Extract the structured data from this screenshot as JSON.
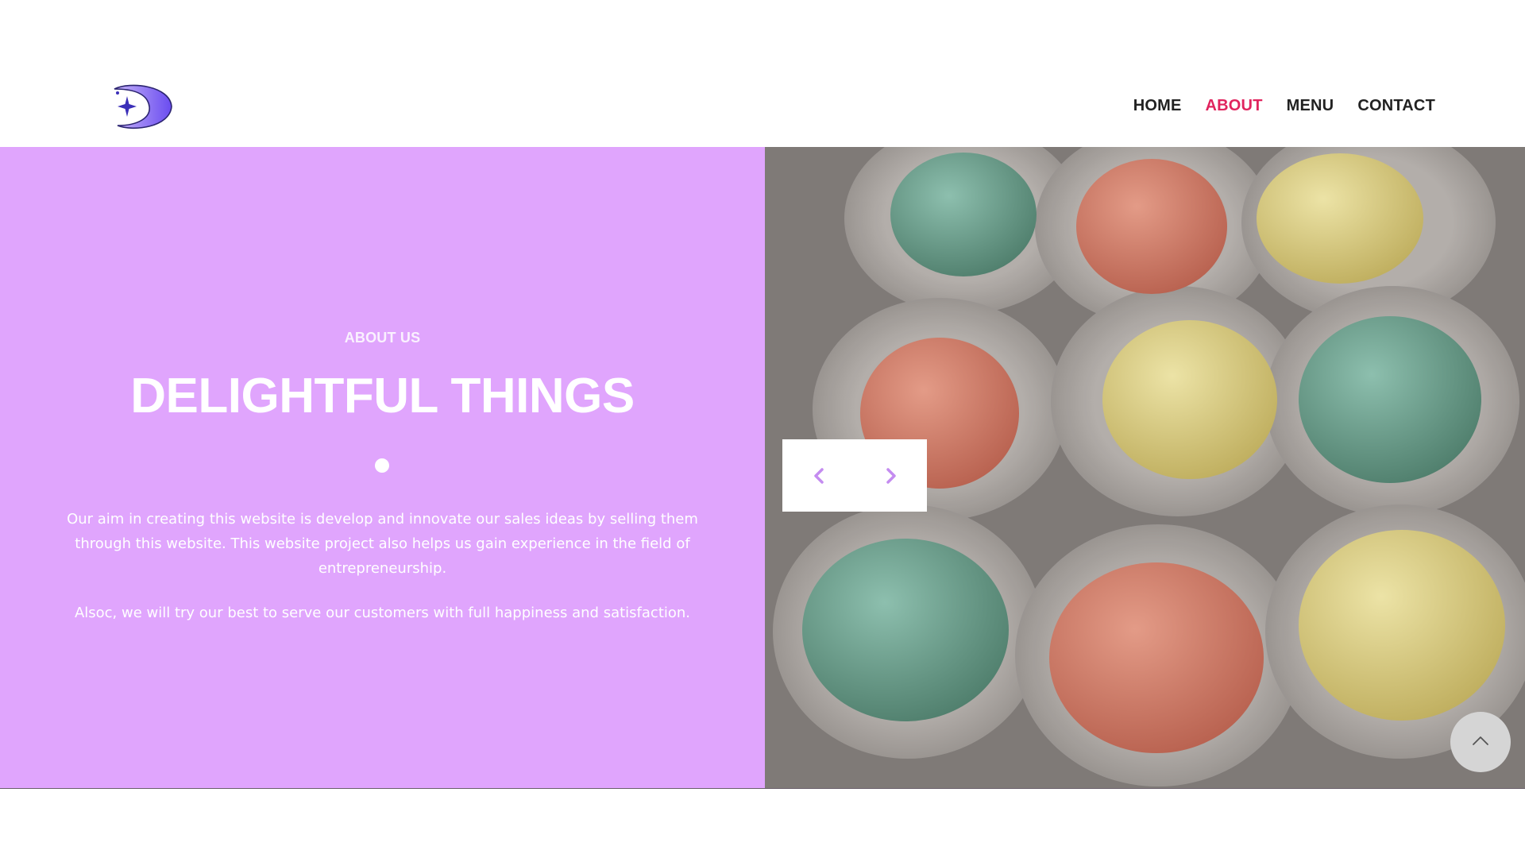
{
  "brand": {
    "logo_icon": "moon-star-logo-icon"
  },
  "nav": {
    "items": [
      {
        "label": "HOME",
        "active": false
      },
      {
        "label": "ABOUT",
        "active": true
      },
      {
        "label": "MENU",
        "active": false
      },
      {
        "label": "CONTACT",
        "active": false
      }
    ]
  },
  "about": {
    "eyebrow": "ABOUT US",
    "title": "DELIGHTFUL THINGS",
    "paragraph1": "Our aim in creating this website is develop and innovate our sales ideas by selling them through this website. This website project also helps us gain experience in the field of entrepreneurship.",
    "paragraph2": "Alsoc, we will try our best to serve our customers with full happiness and satisfaction."
  },
  "carousel": {
    "prev_icon": "chevron-left-icon",
    "next_icon": "chevron-right-icon"
  },
  "scroll_top": {
    "icon": "chevron-up-icon"
  },
  "colors": {
    "panel": "#e0a5fd",
    "nav_active": "#e0245e",
    "nav_text": "#222222",
    "arrow": "#c48cf0"
  }
}
